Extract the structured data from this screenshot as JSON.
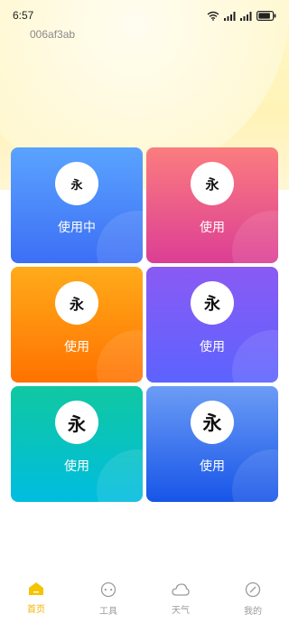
{
  "status_bar": {
    "time": "6:57",
    "icons": [
      "wifi-icon",
      "signal-icon",
      "signal-icon",
      "battery-icon"
    ]
  },
  "header": {
    "user_id": "006af3ab"
  },
  "styles": [
    {
      "glyph": "永",
      "label": "使用中",
      "colors": [
        "#5aa3ff",
        "#3d6ff5"
      ],
      "status": "in-use"
    },
    {
      "glyph": "永",
      "label": "使用",
      "colors": [
        "#fb7d7f",
        "#dc3e94"
      ]
    },
    {
      "glyph": "永",
      "label": "使用",
      "colors": [
        "#ffab1a",
        "#ff7200"
      ]
    },
    {
      "glyph": "永",
      "label": "使用",
      "colors": [
        "#8b5af4",
        "#5c63ff"
      ]
    },
    {
      "glyph": "永",
      "label": "使用",
      "colors": [
        "#10c8a0",
        "#00bde0"
      ]
    },
    {
      "glyph": "永",
      "label": "使用",
      "colors": [
        "#6c9cf5",
        "#1755e8"
      ]
    }
  ],
  "tabbar": {
    "items": [
      {
        "label": "首页",
        "icon": "home-icon",
        "active": true
      },
      {
        "label": "工具",
        "icon": "tools-icon",
        "active": false
      },
      {
        "label": "天气",
        "icon": "weather-icon",
        "active": false
      },
      {
        "label": "我的",
        "icon": "profile-icon",
        "active": false
      }
    ],
    "active_color": "#f2b400",
    "inactive_color": "#9a9a9a"
  }
}
